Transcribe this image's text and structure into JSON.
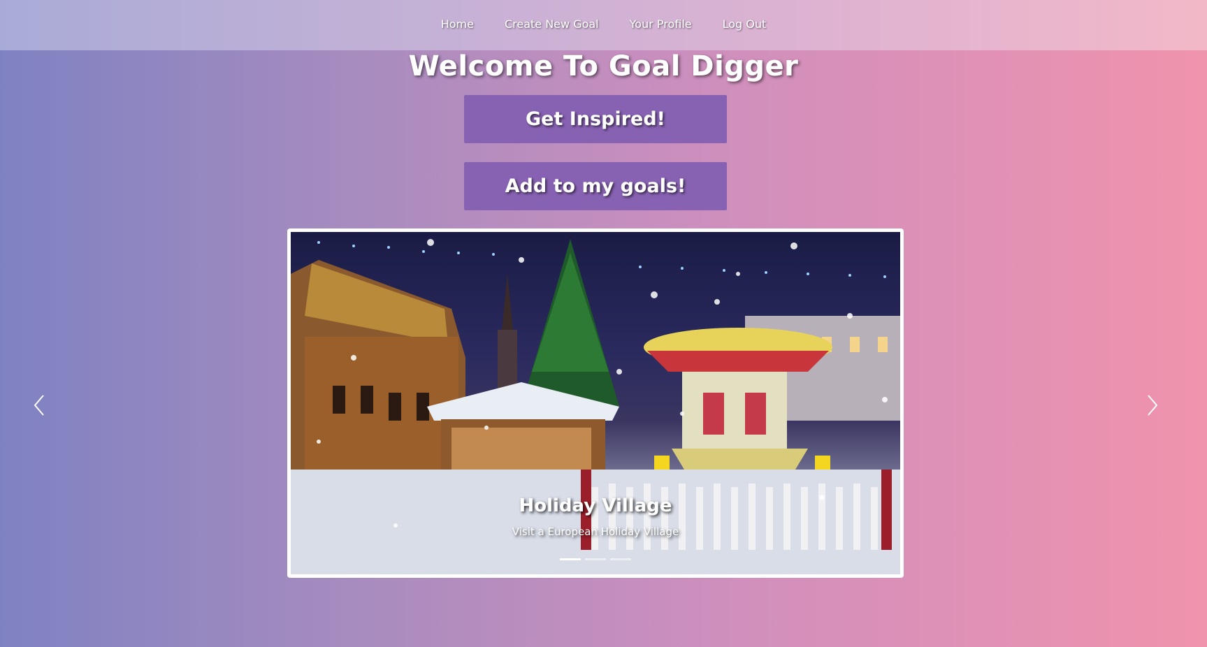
{
  "nav": {
    "items": [
      {
        "label": "Home"
      },
      {
        "label": "Create New Goal"
      },
      {
        "label": "Your Profile"
      },
      {
        "label": "Log Out"
      }
    ]
  },
  "header": {
    "title": "Welcome To Goal Digger"
  },
  "actions": {
    "inspire_label": "Get Inspired!",
    "add_label": "Add to my goals!"
  },
  "carousel": {
    "slide_title": "Holiday Village",
    "slide_subtitle": "Visit a European Holiday Village",
    "indicator_count": 3,
    "active_index": 0,
    "prev_icon": "chevron-left-icon",
    "next_icon": "chevron-right-icon"
  },
  "colors": {
    "button": "#8761b2",
    "gradient_start": "#7f82c2",
    "gradient_end": "#f093ad"
  }
}
